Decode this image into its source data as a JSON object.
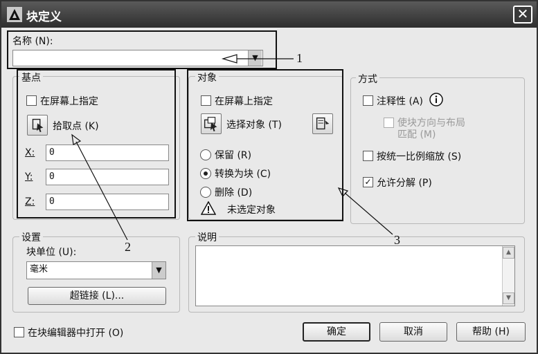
{
  "window": {
    "title": "块定义",
    "close_symbol": "✕"
  },
  "name": {
    "label": "名称 (N):",
    "value": ""
  },
  "base_point": {
    "title": "基点",
    "on_screen_label": "在屏幕上指定",
    "pick_point_label": "拾取点 (K)",
    "x_label": "X:",
    "x_value": "0",
    "y_label": "Y:",
    "y_value": "0",
    "z_label": "Z:",
    "z_value": "0"
  },
  "objects": {
    "title": "对象",
    "on_screen_label": "在屏幕上指定",
    "select_objects_label": "选择对象 (T)",
    "retain_label": "保留 (R)",
    "convert_label": "转换为块 (C)",
    "delete_label": "删除 (D)",
    "warning_text": "未选定对象",
    "selected_option": "convert"
  },
  "behavior": {
    "title": "方式",
    "annotative_label": "注释性 (A)",
    "annotative_checked": false,
    "match_orientation_line1": "使块方向与布局",
    "match_orientation_line2": "匹配 (M)",
    "scale_uniformly_label": "按统一比例缩放 (S)",
    "scale_uniformly_checked": false,
    "allow_explode_label": "允许分解 (P)",
    "allow_explode_checked": true,
    "check_mark": "✓"
  },
  "settings": {
    "title": "设置",
    "block_unit_label": "块单位 (U):",
    "block_unit_value": "毫米",
    "hyperlink_label": "超链接 (L)..."
  },
  "description": {
    "title": "说明",
    "value": ""
  },
  "footer": {
    "open_in_editor_label": "在块编辑器中打开 (O)",
    "ok_label": "确定",
    "cancel_label": "取消",
    "help_label": "帮助 (H)"
  },
  "callouts": {
    "one": "1",
    "two": "2",
    "three": "3"
  }
}
